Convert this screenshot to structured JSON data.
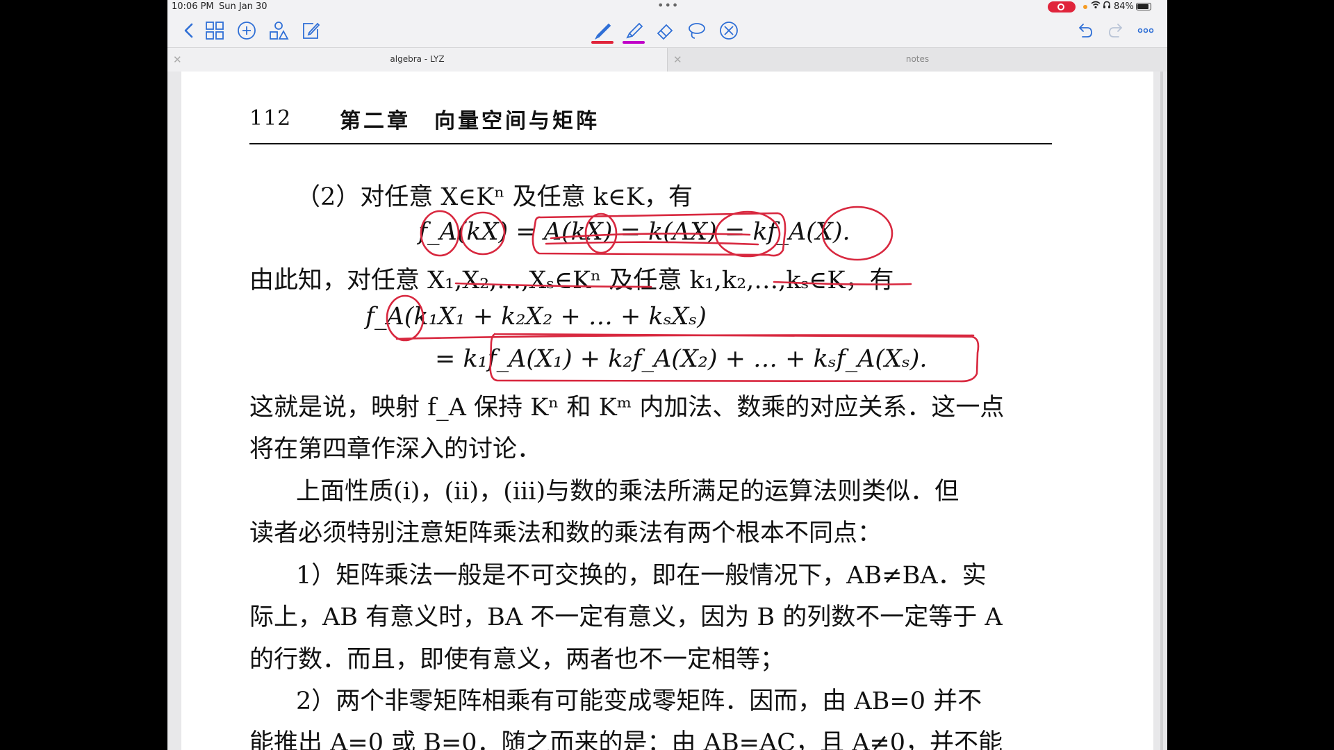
{
  "status_bar": {
    "time": "10:06 PM",
    "date": "Sun Jan 30",
    "battery": "84%",
    "dots": "•••"
  },
  "toolbar": {
    "icons": [
      "back-icon",
      "grid-icon",
      "add-icon",
      "shapes-icon",
      "edit-icon",
      "pen-icon",
      "highlighter-icon",
      "eraser-icon",
      "lasso-icon",
      "close-circle-icon",
      "undo-icon",
      "redo-icon",
      "more-icon"
    ],
    "pen_color": "#e0243b",
    "highlighter_color": "#c000c8",
    "accent": "#2f6fd6"
  },
  "tabs": [
    {
      "title": "algebra - LYZ",
      "active": true
    },
    {
      "title": "notes",
      "active": false
    }
  ],
  "page": {
    "page_number": "112",
    "chapter_title": "第二章　向量空间与矩阵",
    "lines": [
      "（2）对任意 X∈Kⁿ 及任意 k∈K，有",
      "f_A(kX) = A(kX) = k(AX) = kf_A(X).",
      "由此知，对任意 X₁,X₂,…,Xₛ∈Kⁿ 及任意 k₁,k₂,…,kₛ∈K，有",
      "f_A(k₁X₁ + k₂X₂ + … + kₛXₛ)",
      "= k₁f_A(X₁) + k₂f_A(X₂) + … + kₛf_A(Xₛ).",
      "这就是说，映射 f_A 保持 Kⁿ 和 Kᵐ 内加法、数乘的对应关系．这一点",
      "将在第四章作深入的讨论．",
      "上面性质(i)，(ii)，(iii)与数的乘法所满足的运算法则类似．但",
      "读者必须特别注意矩阵乘法和数的乘法有两个根本不同点：",
      "1）矩阵乘法一般是不可交换的，即在一般情况下，AB≠BA．实",
      "际上，AB 有意义时，BA 不一定有意义，因为 B 的列数不一定等于 A",
      "的行数．而且，即使有意义，两者也不一定相等；",
      "2）两个非零矩阵相乘有可能变成零矩阵．因而，由 AB=0 并不",
      "能推出 A=0 或 B=0．随之而来的是：由 AB=AC，且 A≠0，并不能"
    ]
  },
  "annotation_color": "#d8283f"
}
